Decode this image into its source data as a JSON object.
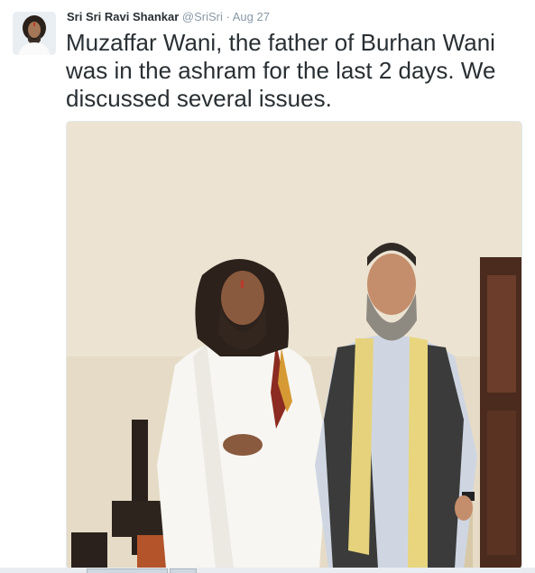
{
  "tweet": {
    "author_name": "Sri Sri Ravi Shankar",
    "author_handle": "@SriSri",
    "separator": "·",
    "date": "Aug 27",
    "text": "Muzaffar Wani, the father of Burhan Wani was in the ashram for the last 2 days. We discussed several issues."
  },
  "icons": {
    "avatar": "profile-photo",
    "media": "photo-two-men-standing"
  },
  "colors": {
    "name": "#292f33",
    "meta": "#8899a6",
    "text": "#292f33",
    "border": "#e1e8ed"
  }
}
